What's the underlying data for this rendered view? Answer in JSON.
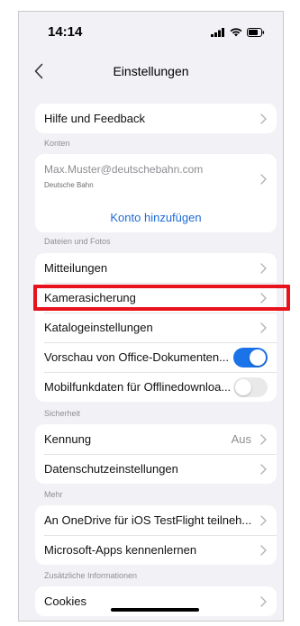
{
  "status_bar": {
    "time": "14:14",
    "icons": [
      "signal-icon",
      "wifi-icon",
      "battery-icon"
    ]
  },
  "nav": {
    "title": "Einstellungen",
    "back_icon": "chevron-left-icon"
  },
  "sections": {
    "help": "Hilfe und Feedback",
    "accounts_header": "Konten",
    "account_email": "Max.Muster@deutschebahn.com",
    "account_provider": "Deutsche Bahn",
    "add_account": "Konto hinzufügen",
    "files_header": "Dateien und Fotos",
    "notifications": "Mitteilungen",
    "camera_backup": "Kamerasicherung",
    "catalog_settings": "Katalogeinstellungen",
    "office_preview": "Vorschau von Office-Dokumenten...",
    "mobile_data": "Mobilfunkdaten für Offlinedownloa...",
    "security_header": "Sicherheit",
    "passcode": "Kennung",
    "passcode_value": "Aus",
    "privacy": "Datenschutzeinstellungen",
    "more_header": "Mehr",
    "testflight": "An OneDrive für iOS TestFlight teilneh...",
    "microsoft_apps": "Microsoft-Apps kennenlernen",
    "additional_header": "Zusätzliche Informationen",
    "cookies": "Cookies"
  },
  "toggles": {
    "office_preview_on": true,
    "mobile_data_on": false
  },
  "colors": {
    "accent": "#1a73e8",
    "link": "#1e6bd6",
    "highlight": "#e8121c",
    "background": "#f2f2f6"
  }
}
